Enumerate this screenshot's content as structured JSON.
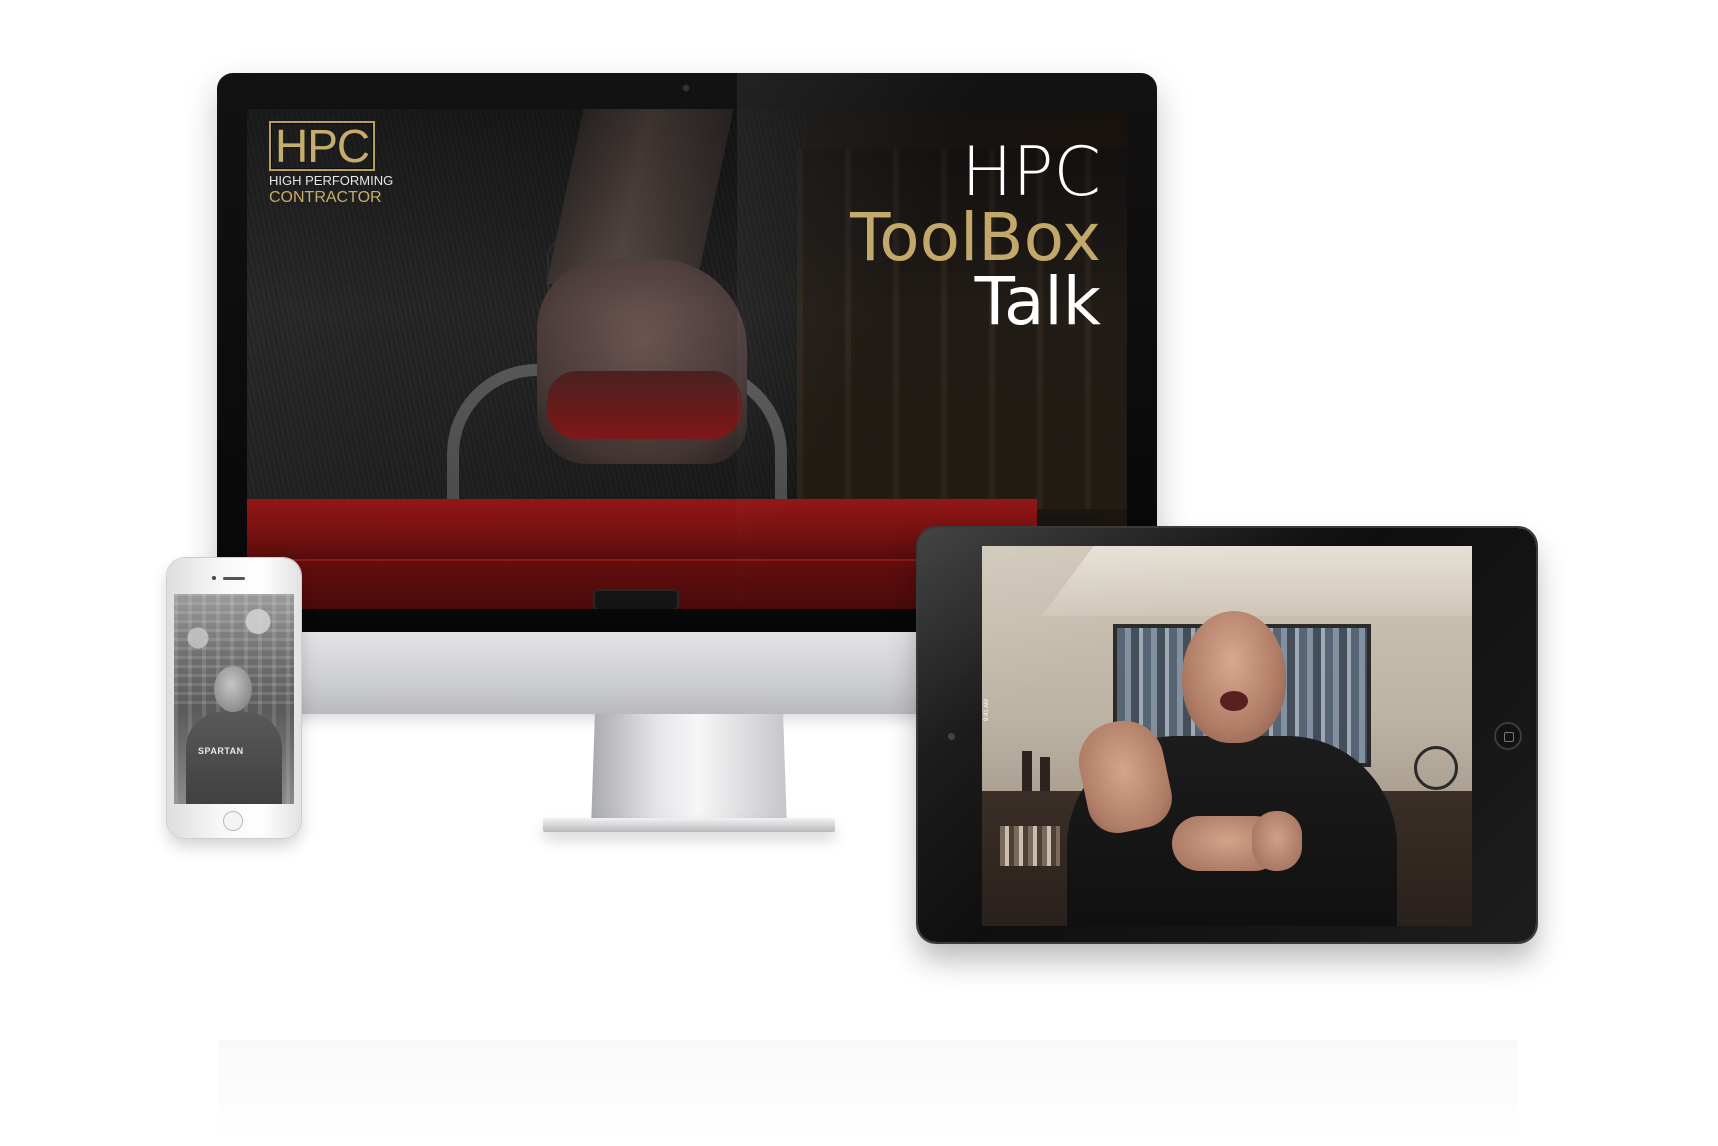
{
  "monitor": {
    "logo": {
      "mark": "HPC",
      "line1": "HIGH PERFORMING",
      "line2": "CONTRACTOR"
    },
    "title": {
      "line1": "HPC",
      "line2": "ToolBox",
      "line3": "Talk"
    }
  },
  "phone": {
    "shirt_text": "SPARTAN"
  },
  "tablet": {
    "status_text": "9:41 AM"
  },
  "colors": {
    "accent_gold": "#c2a86a",
    "toolbox_red": "#b01b1b",
    "background": "#ffffff"
  }
}
